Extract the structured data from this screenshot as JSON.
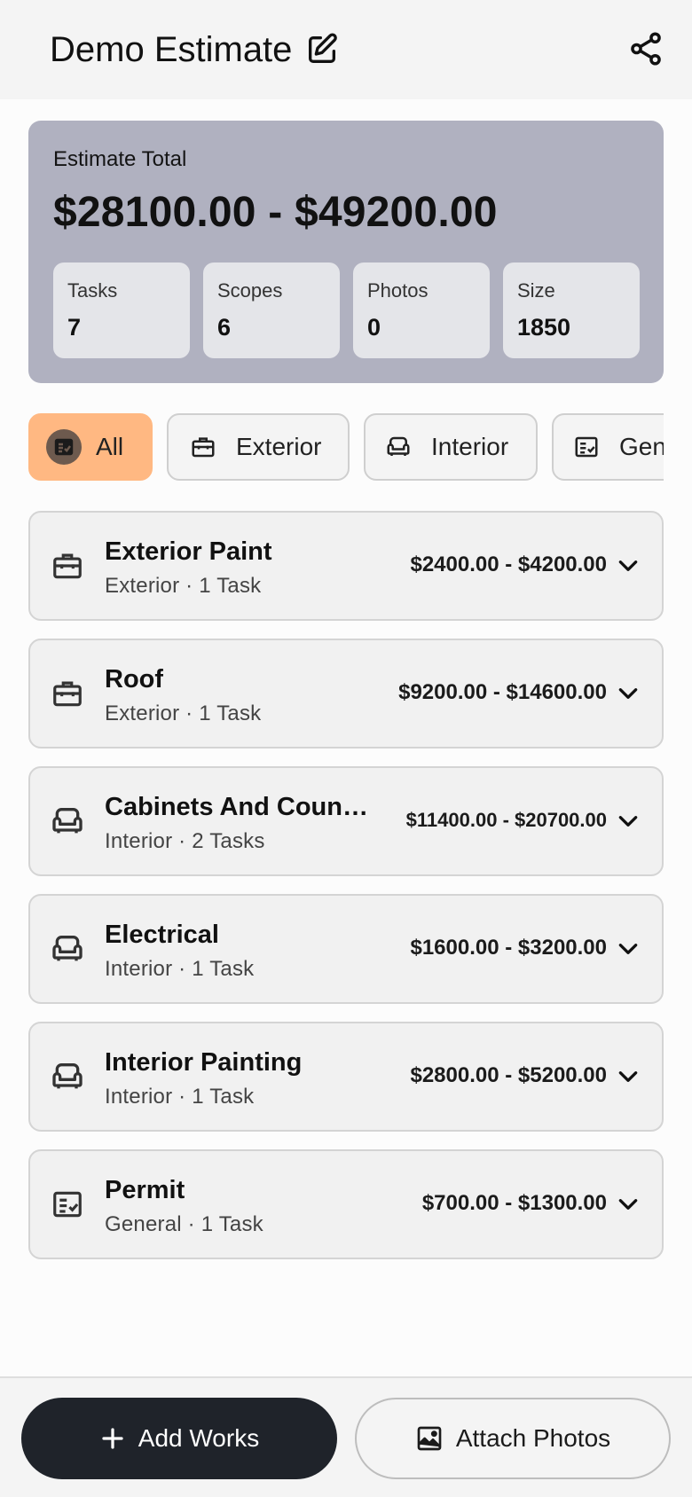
{
  "header": {
    "title": "Demo Estimate",
    "edit_icon": "edit-icon",
    "share_icon": "share-icon"
  },
  "summary": {
    "label": "Estimate Total",
    "amount": "$28100.00 - $49200.00",
    "stats": [
      {
        "label": "Tasks",
        "value": "7"
      },
      {
        "label": "Scopes",
        "value": "6"
      },
      {
        "label": "Photos",
        "value": "0"
      },
      {
        "label": "Size",
        "value": "1850"
      }
    ]
  },
  "filters": [
    {
      "label": "All",
      "icon": "checklist-icon",
      "active": true
    },
    {
      "label": "Exterior",
      "icon": "toolbox-icon",
      "active": false
    },
    {
      "label": "Interior",
      "icon": "armchair-icon",
      "active": false
    },
    {
      "label": "General",
      "icon": "checklist-icon",
      "active": false
    }
  ],
  "scopes": [
    {
      "title": "Exterior Paint",
      "category": "Exterior",
      "tasks": "1 Task",
      "price": "$2400.00 - $4200.00",
      "icon": "toolbox-icon"
    },
    {
      "title": "Roof",
      "category": "Exterior",
      "tasks": "1 Task",
      "price": "$9200.00 - $14600.00",
      "icon": "toolbox-icon"
    },
    {
      "title": "Cabinets And Countertops",
      "category": "Interior",
      "tasks": "2 Tasks",
      "price": "$11400.00 - $20700.00",
      "icon": "armchair-icon"
    },
    {
      "title": "Electrical",
      "category": "Interior",
      "tasks": "1 Task",
      "price": "$1600.00 - $3200.00",
      "icon": "armchair-icon"
    },
    {
      "title": "Interior Painting",
      "category": "Interior",
      "tasks": "1 Task",
      "price": "$2800.00 - $5200.00",
      "icon": "armchair-icon"
    },
    {
      "title": "Permit",
      "category": "General",
      "tasks": "1 Task",
      "price": "$700.00 - $1300.00",
      "icon": "checklist-icon"
    }
  ],
  "actions": {
    "add_label": "Add Works",
    "attach_label": "Attach Photos"
  },
  "colors": {
    "summary_bg": "#b0b1c0",
    "active_chip": "#ffb882",
    "primary_button": "#1f232a"
  }
}
